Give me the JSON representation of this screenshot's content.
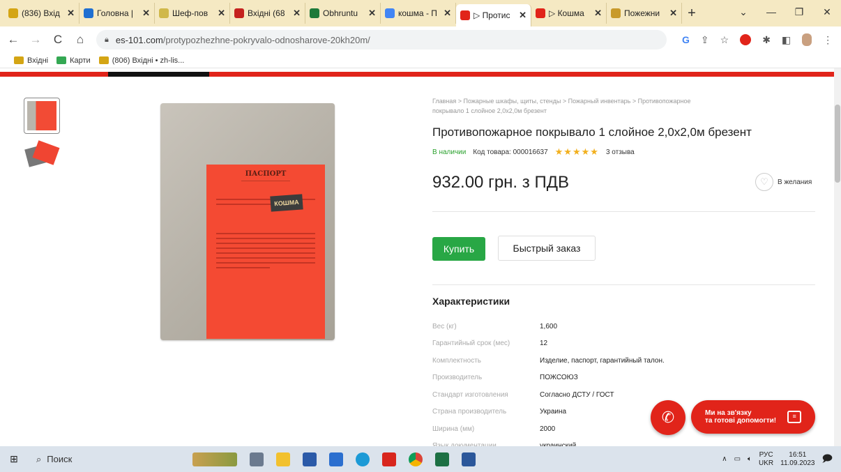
{
  "browser": {
    "tabs": [
      {
        "label": "(836) Вхід",
        "color": "#d4a514",
        "active": false
      },
      {
        "label": "Головна |",
        "color": "#1f6fd1",
        "active": false
      },
      {
        "label": "Шеф-пов",
        "color": "#d0b84a",
        "active": false
      },
      {
        "label": "Вхідні (68",
        "color": "#c5221f",
        "active": false
      },
      {
        "label": "Obhruntu",
        "color": "#1e7a3a",
        "active": false
      },
      {
        "label": "кошма - П",
        "color": "#4285f4",
        "active": false
      },
      {
        "label": "▷ Протис",
        "color": "#e1241a",
        "active": true
      },
      {
        "label": "▷ Кошма",
        "color": "#e1241a",
        "active": false
      },
      {
        "label": "Пожежни",
        "color": "#c89a2a",
        "active": false
      }
    ],
    "new_tab": "+",
    "url_host": "es-101.com",
    "url_path": "/protypozhezhne-pokryvalo-odnosharove-20kh20m/",
    "bookmarks": [
      "Вхідні",
      "Карти",
      "(806) Вхідні • zh-lis..."
    ]
  },
  "product": {
    "breadcrumb": "Главная  >  Пожарные шкафы, щиты, стенды  >  Пожарный инвентарь  >  Противопожарное покрывало 1 слойное 2,0x2,0м брезент",
    "title": "Противопожарное покрывало 1 слойное 2,0х2,0м брезент",
    "stock": "В наличии",
    "code": "Код товара: 000016637",
    "stars": "★★★★★",
    "rating": 5,
    "reviews": "3 отзыва",
    "price": "932.00 грн. з ПДВ",
    "wishlist": "В желания",
    "buy_button": "Купить",
    "quick_order": "Быстрый заказ",
    "passport_title": "ПАСПОРТ",
    "passport_brand": "КОШМА"
  },
  "characteristics": {
    "heading": "Характеристики",
    "rows": [
      {
        "key": "Вес (кг)",
        "value": "1,600"
      },
      {
        "key": "Гарантийный срок (мес)",
        "value": "12"
      },
      {
        "key": "Комплектность",
        "value": "Изделие, паспорт, гарантийный талон."
      },
      {
        "key": "Производитель",
        "value": "ПОЖСОЮЗ"
      },
      {
        "key": "Стандарт изготовления",
        "value": "Согласно ДСТУ / ГОСТ"
      },
      {
        "key": "Страна производитель",
        "value": "Украина"
      },
      {
        "key": "Ширина (мм)",
        "value": "2000"
      },
      {
        "key": "Язык документации",
        "value": "украинский"
      }
    ]
  },
  "help": {
    "line1": "Ми на зв'язку",
    "line2": "та готові допомогти!"
  },
  "taskbar": {
    "search": "Поиск",
    "lang_top": "РУС",
    "lang_bottom": "UKR",
    "time": "16:51",
    "date": "11.09.2023"
  }
}
